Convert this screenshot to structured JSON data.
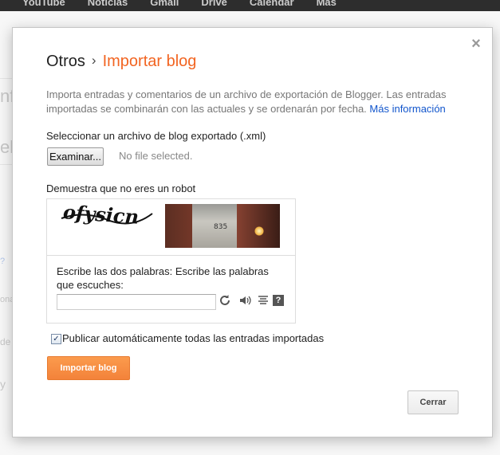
{
  "gbar": {
    "links": [
      "YouTube",
      "Noticias",
      "Gmail",
      "Drive",
      "Calendar",
      "Más"
    ]
  },
  "background": {
    "fragments": [
      "nf",
      "el",
      "?",
      "ona",
      "de",
      "y"
    ]
  },
  "dialog": {
    "close_icon": "×",
    "breadcrumb_parent": "Otros",
    "breadcrumb_separator": "›",
    "title": "Importar blog",
    "description": "Importa entradas y comentarios de un archivo de exportación de Blogger. Las entradas importadas se combinarán con las actuales y se ordenarán por fecha.",
    "more_info_link": "Más información",
    "file_label": "Seleccionar un archivo de blog exportado (.xml)",
    "file_button": "Examinar...",
    "file_status": "No file selected.",
    "robot_label": "Demuestra que no eres un robot",
    "captcha": {
      "word_image": "ofysicn",
      "photo_number": "835",
      "prompt": "Escribe las dos palabras: Escribe las palabras que escuches:",
      "input_value": "",
      "help_icon": "?"
    },
    "auto_publish_checked": true,
    "auto_publish_label": "Publicar automáticamente todas las entradas importadas",
    "import_button": "Importar blog",
    "close_button": "Cerrar"
  },
  "colors": {
    "accent": "#f26522",
    "link": "#1155cc",
    "button_orange": "#f5873c"
  }
}
